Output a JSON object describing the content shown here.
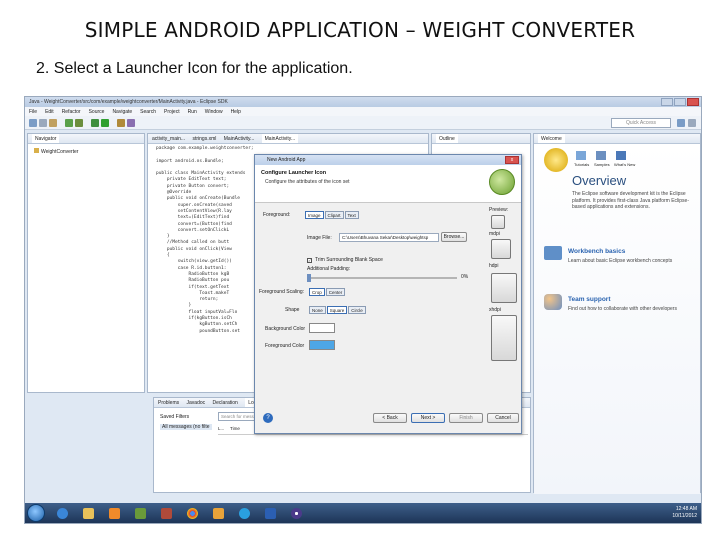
{
  "slide": {
    "title": "SIMPLE ANDROID APPLICATION – WEIGHT CONVERTER",
    "subtitle": "2. Select a Launcher Icon for the application."
  },
  "window": {
    "title": "Java - WeightConverter/src/com/example/weightconverter/MainActivity.java - Eclipse SDK",
    "menu": [
      "File",
      "Edit",
      "Refactor",
      "Source",
      "Navigate",
      "Search",
      "Project",
      "Run",
      "Window",
      "Help"
    ],
    "quick_access": "Quick Access"
  },
  "package_explorer": {
    "tab": "Navigator",
    "item": "WeightConverter"
  },
  "editor": {
    "tabs": [
      "activity_main...",
      "strings.xml",
      "MainActivity...",
      "MainActivity..."
    ],
    "lines": [
      "package com.example.weightconverter;",
      "",
      "import android.os.Bundle;",
      "",
      "public class MainActivity extends",
      "    private EditText text;",
      "    private Button convert;",
      "    @Override",
      "    public void onCreate(Bundle",
      "        super.onCreate(saved",
      "        setContentView(R.lay",
      "        text=(EditText)find",
      "        convert=(Button)find",
      "        convert.setOnClickL",
      "    }",
      "    //Method called on butt",
      "    public void onClick(View",
      "    {",
      "        switch(view.getId())",
      "        case R.id.button1:",
      "            RadioButton kgB",
      "            RadioButton pou",
      "            if(text.getText",
      "                Toast.makeT",
      "                return;",
      "            }",
      "            float inputVal=Flo",
      "            if(kgButton.isCh",
      "                kgButton.setCh",
      "                poundButton.set"
    ]
  },
  "outline": {
    "tab": "Outline"
  },
  "welcome": {
    "tab": "Welcome",
    "icons": [
      "Tutorials",
      "Samples",
      "What's New"
    ],
    "heading": "Overview",
    "intro": "The Eclipse software development kit is the Eclipse platform. It provides first-class Java platform Eclipse-based applications and extensions.",
    "sections": [
      {
        "title": "Workbench basics",
        "text": "Learn about basic Eclipse workbench concepts"
      },
      {
        "title": "Team support",
        "text": "Find out how to collaborate with other developers"
      }
    ]
  },
  "dialog": {
    "window_title": "New Android App",
    "header_title": "Configure Launcher Icon",
    "header_desc": "Configure the attributes of the icon set",
    "foreground_label": "Foreground:",
    "foreground_options": [
      "Image",
      "Clipart",
      "Text"
    ],
    "image_file_label": "Image File:",
    "image_file_value": "C:\\Users\\Bhuvana Sekar\\Desktop\\weightsp",
    "browse": "Browse...",
    "trim_label": "Trim Surrounding Blank Space",
    "padding_label": "Additional Padding:",
    "padding_value": "0%",
    "padding_fraction": 0.0,
    "scaling_label": "Foreground Scaling:",
    "scaling_options": [
      "Crop",
      "Center"
    ],
    "shape_label": "Shape",
    "shape_options": [
      "None",
      "Square",
      "Circle"
    ],
    "bg_color_label": "Background Color",
    "fg_color_label": "Foreground Color",
    "fg_color": "#4ea6e6",
    "preview_label": "Preview:",
    "preview_densities": [
      "mdpi",
      "hdpi",
      "xhdpi"
    ],
    "buttons": {
      "back": "< Back",
      "next": "Next >",
      "finish": "Finish",
      "cancel": "Cancel"
    }
  },
  "console": {
    "tabs": [
      "Problems",
      "Javadoc",
      "Declaration",
      "LogCat"
    ],
    "filters_label": "Saved Filters",
    "filter_item": "All messages (no filte",
    "search_placeholder": "Search for messages.",
    "columns": [
      "L...",
      "Time",
      "PID",
      "TID",
      "Application",
      "Tag",
      "Text"
    ]
  },
  "taskbar": {
    "time": "12:48 AM",
    "date": "10/11/2012"
  }
}
